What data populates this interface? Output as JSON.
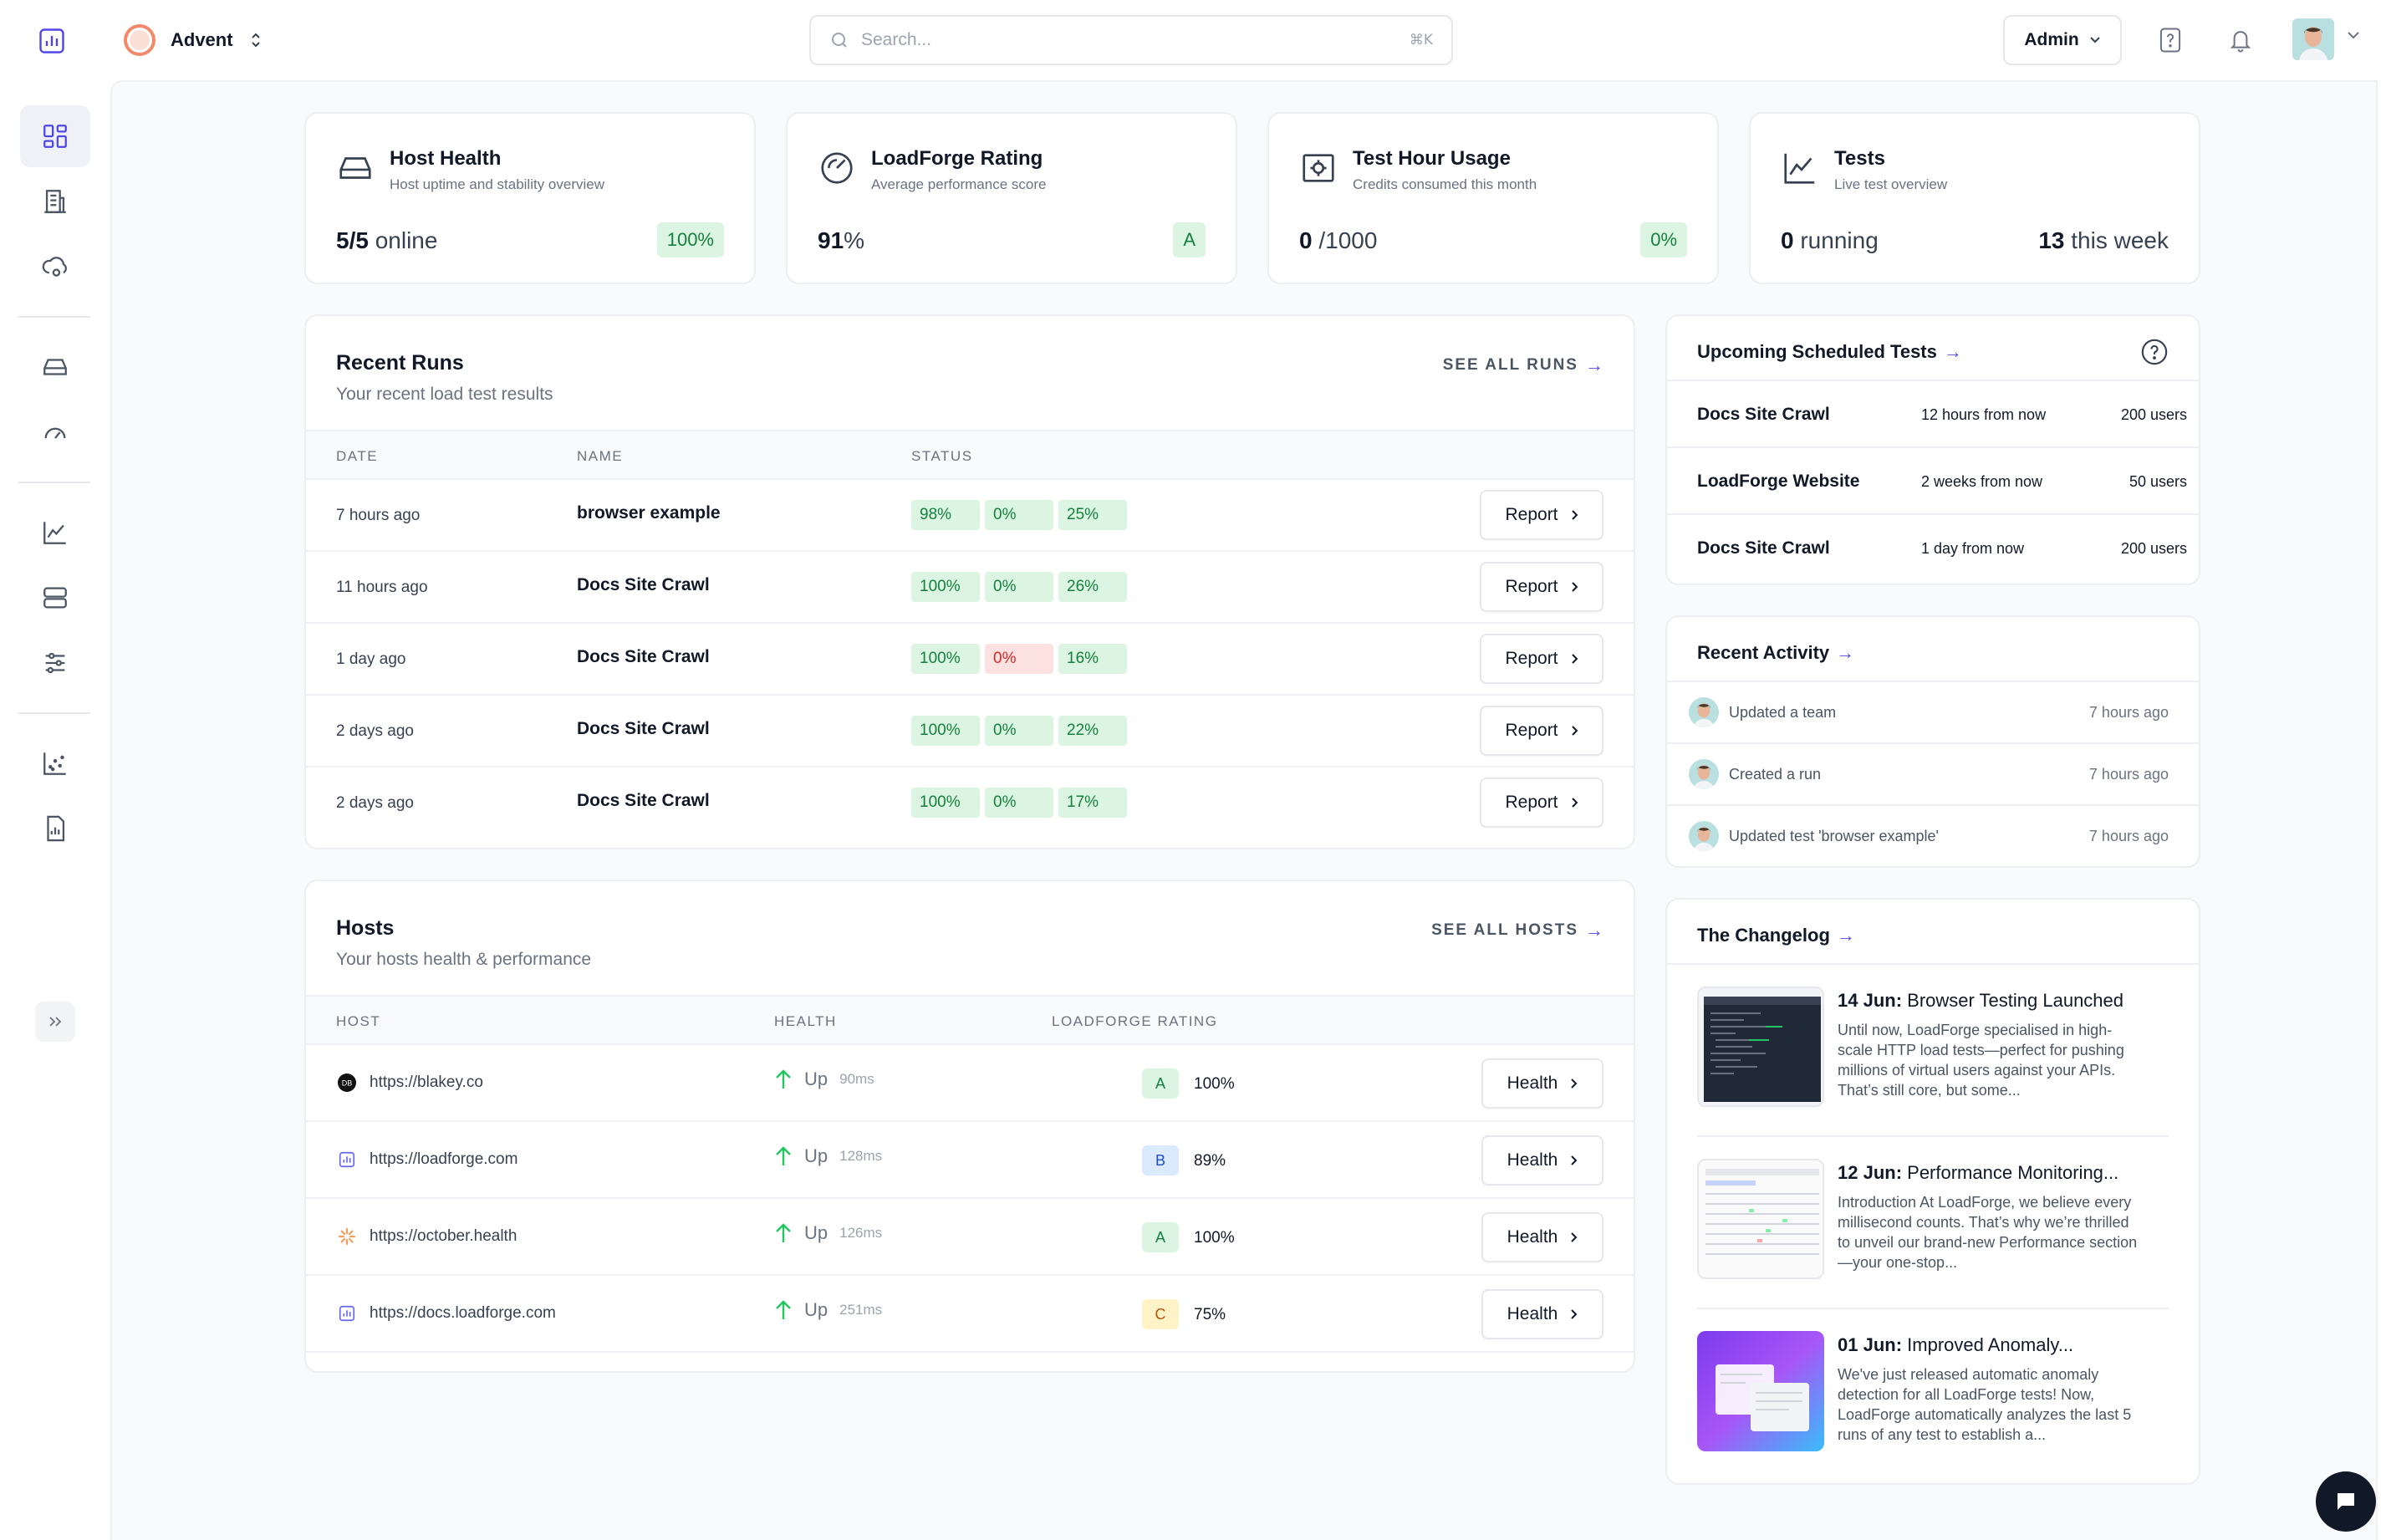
{
  "org": {
    "name": "Advent"
  },
  "search": {
    "placeholder": "Search...",
    "shortcut": "⌘K"
  },
  "header": {
    "role_label": "Admin"
  },
  "stats": [
    {
      "title": "Host Health",
      "subtitle": "Host uptime and stability overview",
      "value_strong": "5/5",
      "value_rest": " online",
      "badge": "100%"
    },
    {
      "title": "LoadForge Rating",
      "subtitle": "Average performance score",
      "value_strong": "91",
      "value_rest": "%",
      "badge": "A"
    },
    {
      "title": "Test Hour Usage",
      "subtitle": "Credits consumed this month",
      "value_strong": "0",
      "value_rest": " /1000",
      "badge": "0%"
    },
    {
      "title": "Tests",
      "subtitle": "Live test overview",
      "value_strong": "0",
      "value_rest": " running",
      "right_strong": "13",
      "right_rest": " this week"
    }
  ],
  "recent_runs": {
    "title": "Recent Runs",
    "subtitle": "Your recent load test results",
    "see_all": "SEE ALL RUNS",
    "columns": {
      "date": "DATE",
      "name": "NAME",
      "status": "STATUS"
    },
    "button_label": "Report",
    "rows": [
      {
        "date": "7 hours ago",
        "name": "browser example",
        "s1": "98%",
        "s2": "0%",
        "s3": "25%"
      },
      {
        "date": "11 hours ago",
        "name": "Docs Site Crawl",
        "s1": "100%",
        "s2": "0%",
        "s3": "26%"
      },
      {
        "date": "1 day ago",
        "name": "Docs Site Crawl",
        "s1": "100%",
        "s2": "0%",
        "s3": "16%"
      },
      {
        "date": "2 days ago",
        "name": "Docs Site Crawl",
        "s1": "100%",
        "s2": "0%",
        "s3": "22%"
      },
      {
        "date": "2 days ago",
        "name": "Docs Site Crawl",
        "s1": "100%",
        "s2": "0%",
        "s3": "17%"
      }
    ]
  },
  "hosts": {
    "title": "Hosts",
    "subtitle": "Your hosts health & performance",
    "see_all": "SEE ALL HOSTS",
    "columns": {
      "host": "HOST",
      "health": "HEALTH",
      "rating": "LOADFORGE RATING"
    },
    "button_label": "Health",
    "rows": [
      {
        "url": "https://blakey.co",
        "status": "Up",
        "ms": "90ms",
        "grade": "A",
        "pct": "100%"
      },
      {
        "url": "https://loadforge.com",
        "status": "Up",
        "ms": "128ms",
        "grade": "B",
        "pct": "89%"
      },
      {
        "url": "https://october.health",
        "status": "Up",
        "ms": "126ms",
        "grade": "A",
        "pct": "100%"
      },
      {
        "url": "https://docs.loadforge.com",
        "status": "Up",
        "ms": "251ms",
        "grade": "C",
        "pct": "75%"
      }
    ]
  },
  "scheduled": {
    "title": "Upcoming Scheduled Tests",
    "rows": [
      {
        "name": "Docs Site Crawl",
        "when": "12 hours from now",
        "users": "200 users"
      },
      {
        "name": "LoadForge Website",
        "when": "2 weeks from now",
        "users": "50 users"
      },
      {
        "name": "Docs Site Crawl",
        "when": "1 day from now",
        "users": "200 users"
      }
    ]
  },
  "activity": {
    "title": "Recent Activity",
    "rows": [
      {
        "text": "Updated a team",
        "time": "7 hours ago"
      },
      {
        "text": "Created a run",
        "time": "7 hours ago"
      },
      {
        "text": "Updated test 'browser example'",
        "time": "7 hours ago"
      }
    ]
  },
  "changelog": {
    "title": "The Changelog",
    "items": [
      {
        "date": "14 Jun:",
        "title": " Browser Testing Launched",
        "body": "Until now, LoadForge specialised in high-scale HTTP load tests—perfect for pushing millions of virtual users against your APIs. That’s still core, but some..."
      },
      {
        "date": "12 Jun:",
        "title": " Performance Monitoring...",
        "body": "Introduction At LoadForge, we believe every millisecond counts. That’s why we’re thrilled to unveil our brand-new Performance section—your one-stop..."
      },
      {
        "date": "01 Jun:",
        "title": " Improved Anomaly...",
        "body": "We've just released automatic anomaly detection for all LoadForge tests! Now, LoadForge automatically analyzes the last 5 runs of any test to establish a..."
      }
    ]
  },
  "colors": {
    "accent": "#4f46e5",
    "success_bg": "#dcf5e3",
    "success_text": "#15803d",
    "danger_bg": "#fde2e2",
    "danger_text": "#dc2626"
  },
  "icons": [
    "chart-logo-icon",
    "dashboard-icon",
    "building-icon",
    "cloud-gear-icon",
    "server-drive-icon",
    "gauge-icon",
    "line-chart-icon",
    "server-stack-icon",
    "sliders-icon",
    "scatter-icon",
    "report-icon",
    "help-icon",
    "bell-icon"
  ]
}
